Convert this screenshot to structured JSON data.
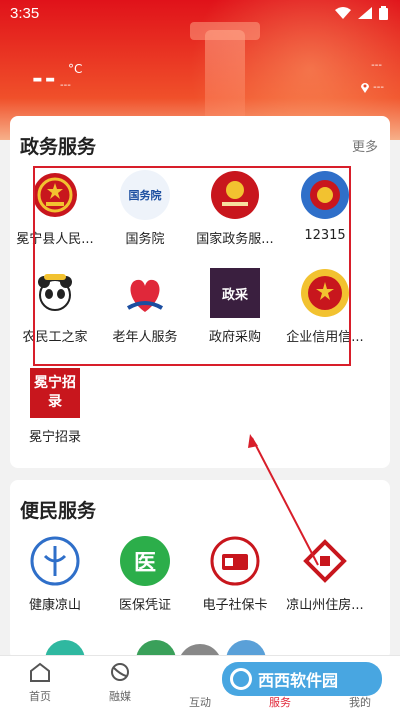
{
  "status": {
    "time": "3:35"
  },
  "weather": {
    "temp": "--",
    "unit": "°C",
    "desc": "---",
    "right_top": "---",
    "location": "---"
  },
  "gov": {
    "title": "政务服务",
    "more": "更多",
    "items": [
      {
        "label": "冕宁县人民..."
      },
      {
        "label": "国务院",
        "badge": "国务院"
      },
      {
        "label": "国家政务服..."
      },
      {
        "label": "12315"
      },
      {
        "label": "农民工之家"
      },
      {
        "label": "老年人服务"
      },
      {
        "label": "政府采购",
        "badge": "政采"
      },
      {
        "label": "企业信用信..."
      },
      {
        "label": "冕宁招录",
        "badge": "冕宁招录"
      }
    ]
  },
  "conv": {
    "title": "便民服务",
    "items": [
      {
        "label": "健康凉山"
      },
      {
        "label": "医保凭证",
        "badge": "医"
      },
      {
        "label": "电子社保卡"
      },
      {
        "label": "凉山州住房..."
      }
    ]
  },
  "tabs": [
    {
      "label": "首页"
    },
    {
      "label": "融媒"
    },
    {
      "label": "互动"
    },
    {
      "label": "服务"
    },
    {
      "label": "我的"
    }
  ],
  "watermark": "西西软件园"
}
